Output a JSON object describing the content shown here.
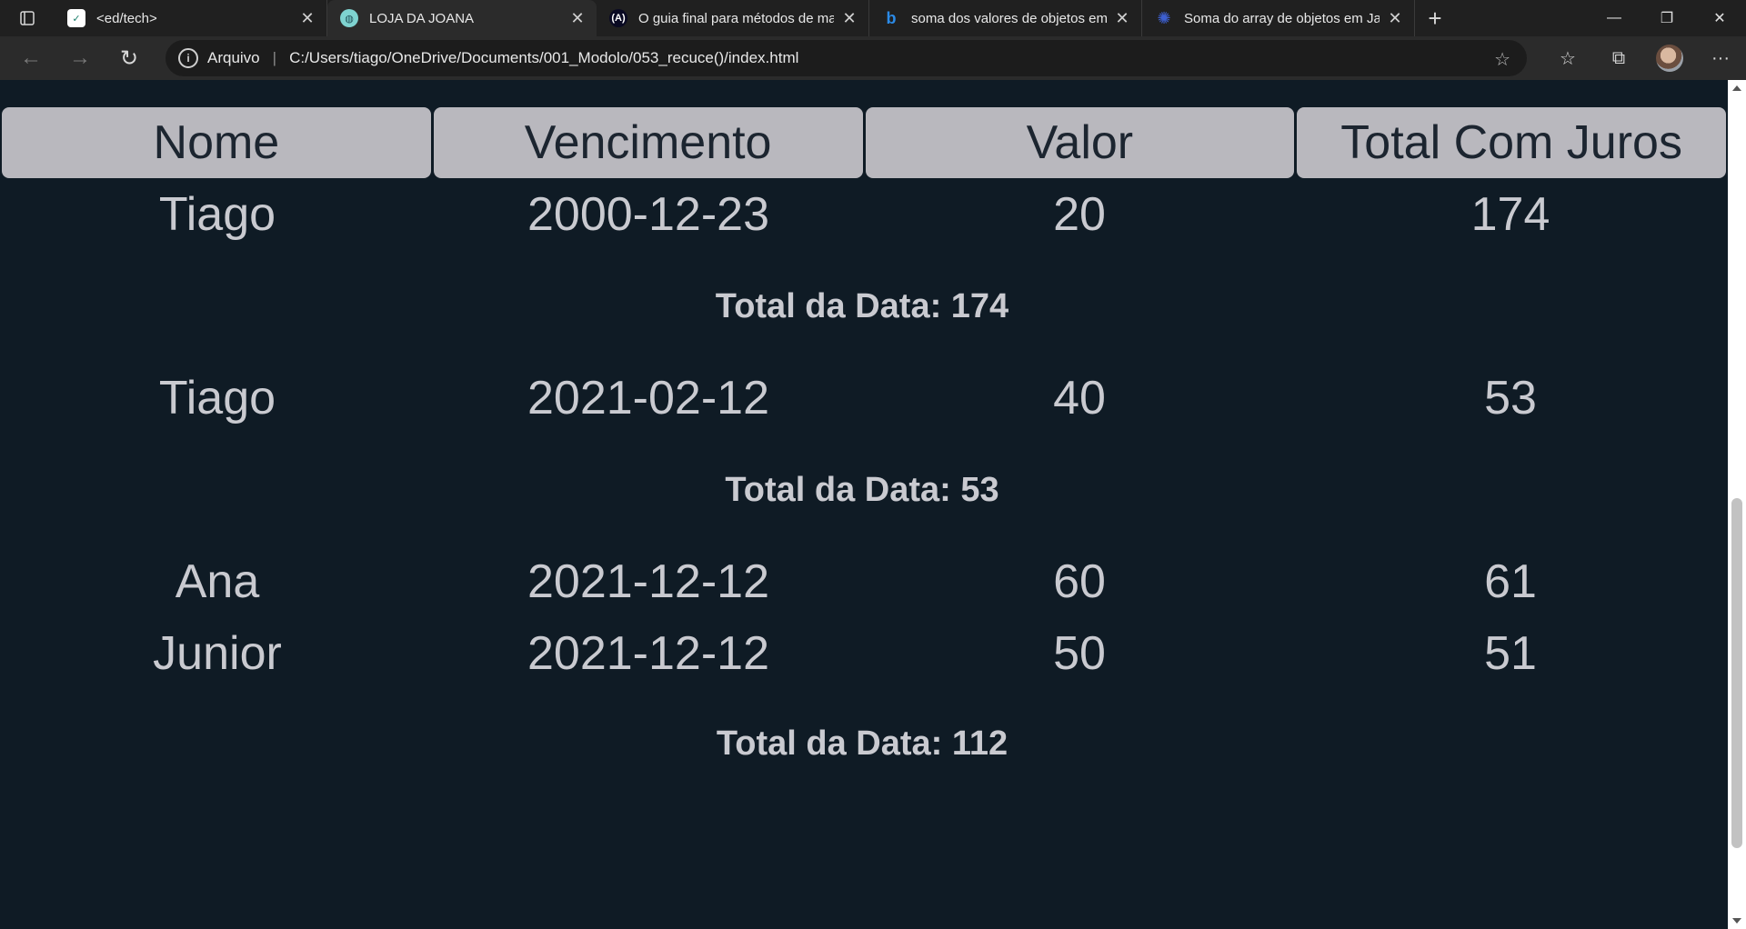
{
  "browser": {
    "tabs": [
      {
        "title": "<ed/tech>",
        "icon": "edtech-icon",
        "active": false
      },
      {
        "title": "LOJA DA JOANA",
        "icon": "globe-icon",
        "active": true
      },
      {
        "title": "O guia final para métodos de ma",
        "icon": "freecodecamp-icon",
        "active": false
      },
      {
        "title": "soma dos valores de objetos em",
        "icon": "bing-icon",
        "active": false
      },
      {
        "title": "Soma do array de objetos em Jav",
        "icon": "gear-icon",
        "active": false
      }
    ],
    "address": {
      "protocol_label": "Arquivo",
      "url": "C:/Users/tiago/OneDrive/Documents/001_Modolo/053_recuce()/index.html"
    }
  },
  "table": {
    "headers": [
      "Nome",
      "Vencimento",
      "Valor",
      "Total Com Juros"
    ],
    "groups": [
      {
        "rows": [
          [
            "Tiago",
            "2000-12-23",
            "20",
            "174"
          ]
        ],
        "total": "Total da Data: 174"
      },
      {
        "rows": [
          [
            "Tiago",
            "2021-02-12",
            "40",
            "53"
          ]
        ],
        "total": "Total da Data: 53"
      },
      {
        "rows": [
          [
            "Ana",
            "2021-12-12",
            "60",
            "61"
          ],
          [
            "Junior",
            "2021-12-12",
            "50",
            "51"
          ]
        ],
        "total": "Total da Data: 112"
      }
    ]
  },
  "colors": {
    "page_bg": "#0f1b25",
    "header_bg": "#b9b8be",
    "text": "#c9cad0"
  }
}
